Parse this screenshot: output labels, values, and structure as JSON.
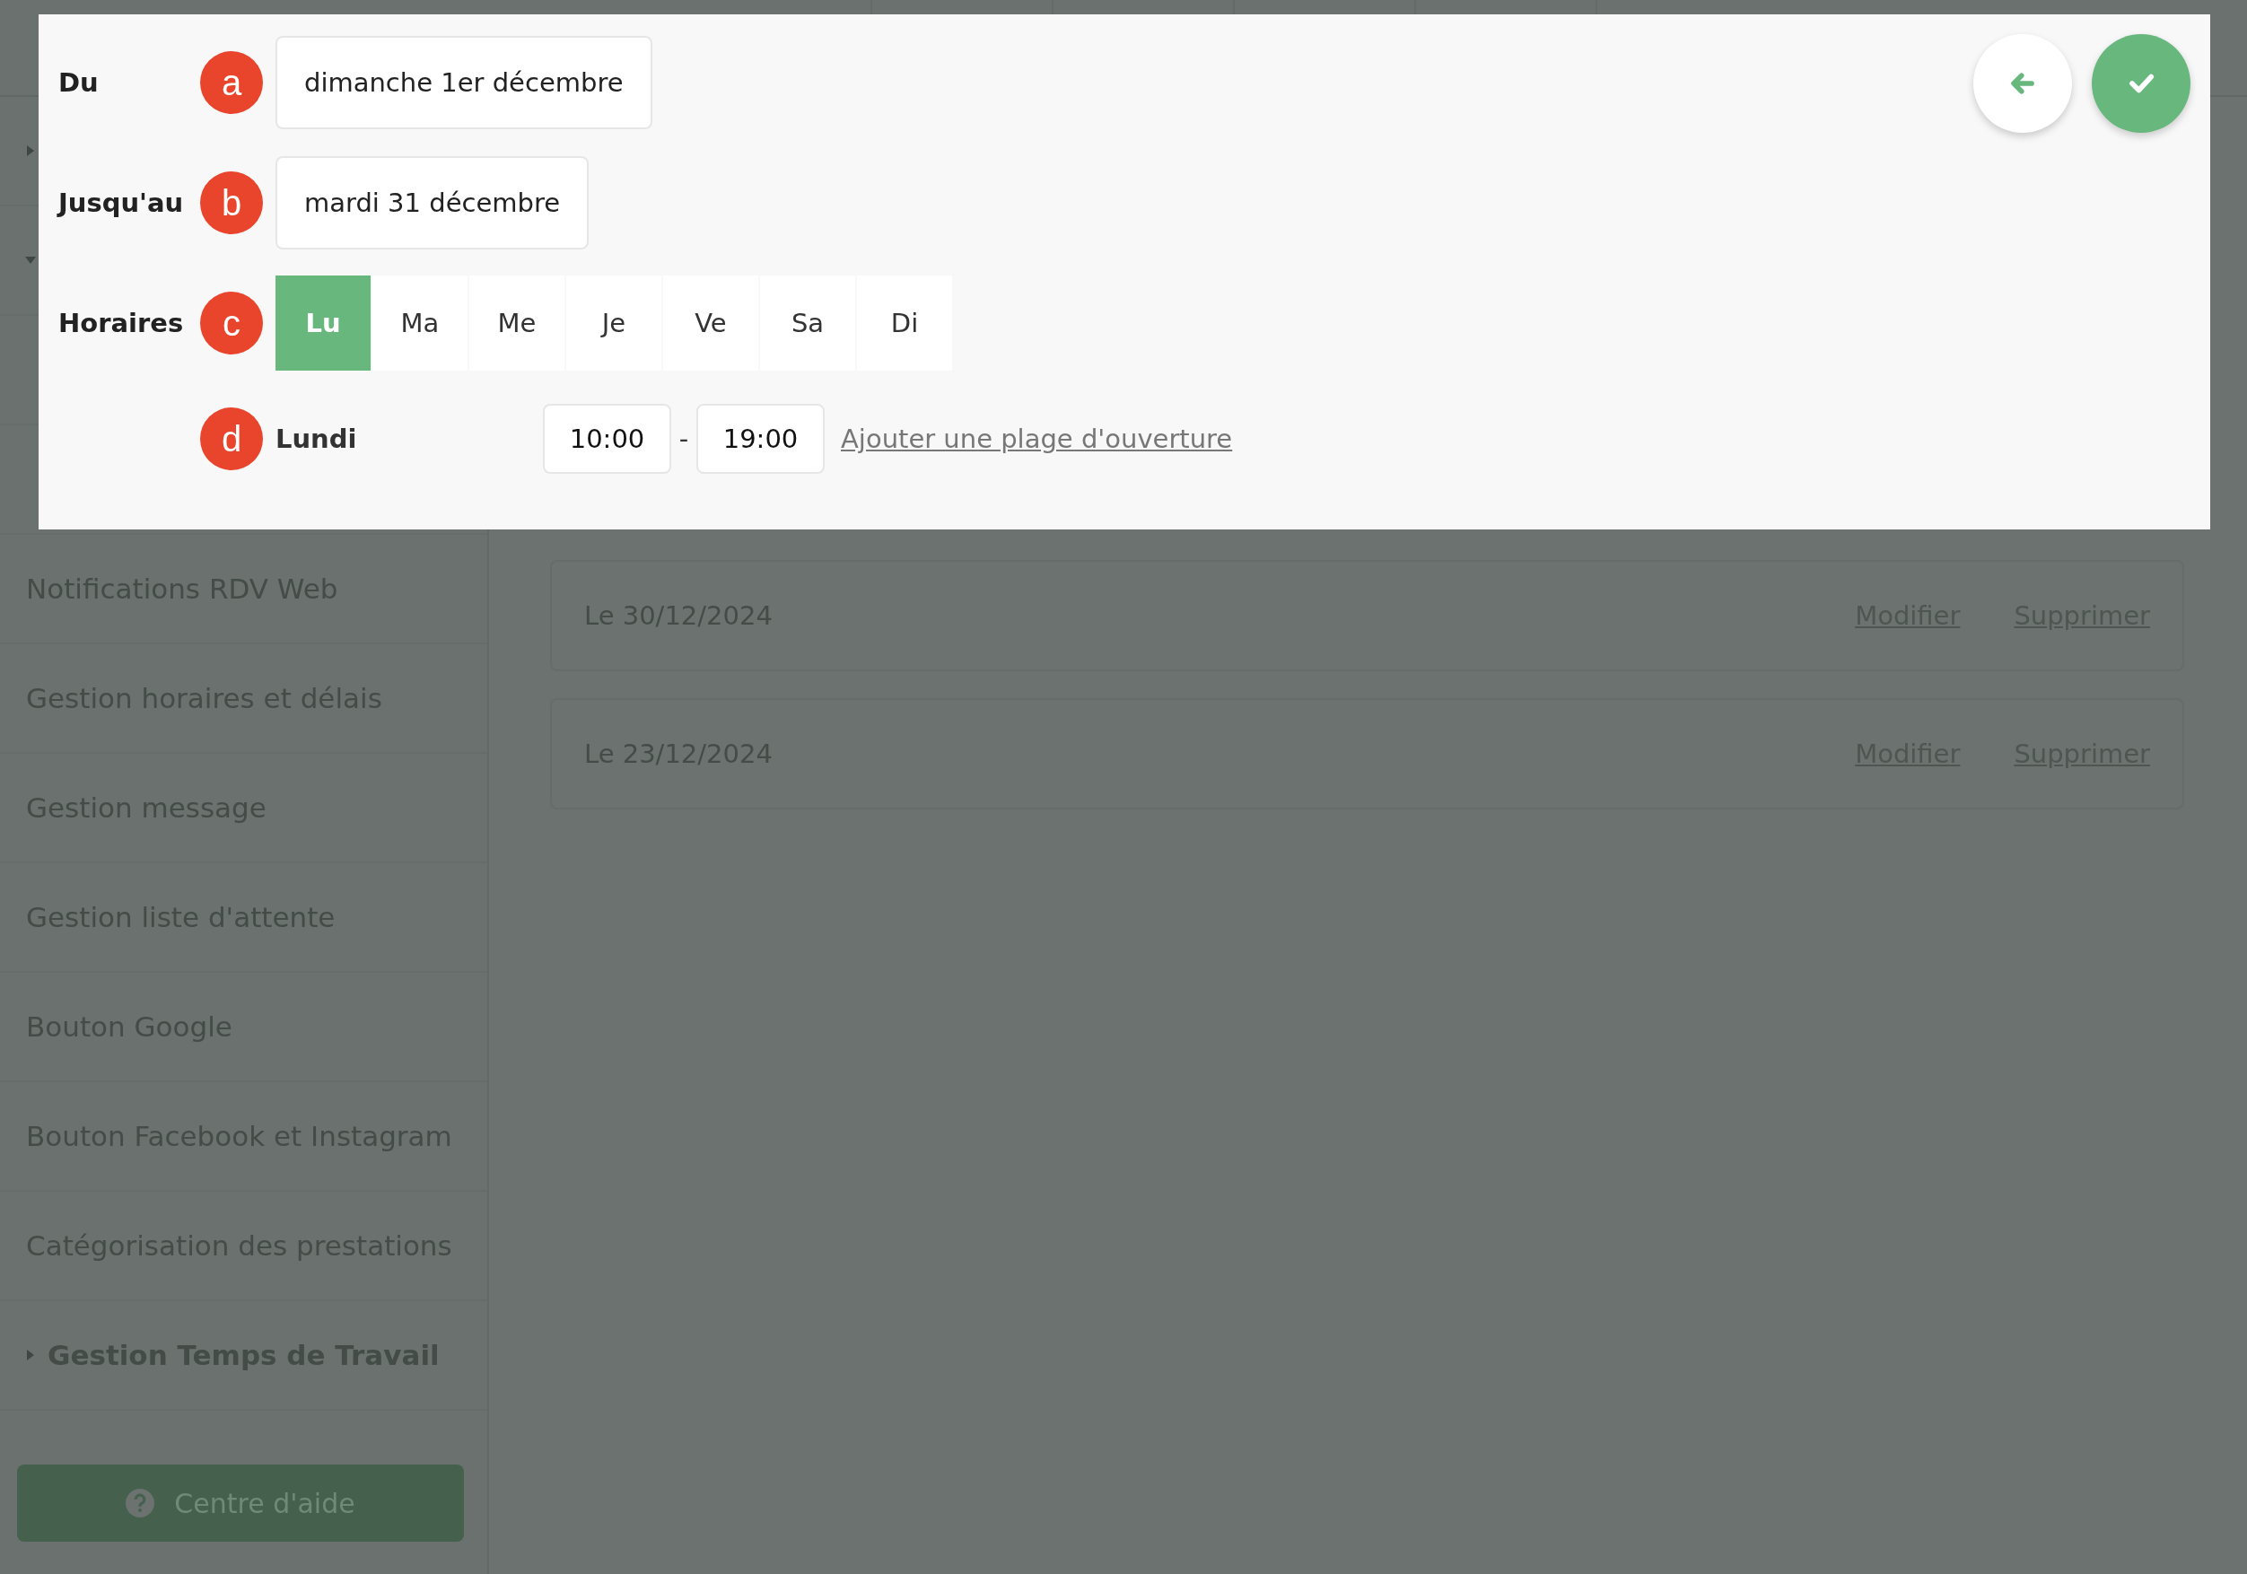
{
  "sidebar": {
    "items": [
      {
        "kind": "group",
        "expanded": false
      },
      {
        "kind": "group",
        "expanded": true
      },
      {
        "kind": "blank"
      },
      {
        "kind": "blank"
      },
      {
        "kind": "link",
        "label": "Notifications RDV Web"
      },
      {
        "kind": "link",
        "label": "Gestion horaires et délais"
      },
      {
        "kind": "link",
        "label": "Gestion message"
      },
      {
        "kind": "link",
        "label": "Gestion liste d'attente"
      },
      {
        "kind": "link",
        "label": "Bouton Google"
      },
      {
        "kind": "link",
        "label": "Bouton Facebook et Instagram"
      },
      {
        "kind": "link",
        "label": "Catégorisation des prestations"
      },
      {
        "kind": "group",
        "label": "Gestion Temps de Travail",
        "expanded": false
      }
    ],
    "help_button": "Centre d'aide"
  },
  "closures": [
    {
      "date": "Le 30/12/2024",
      "edit": "Modifier",
      "delete": "Supprimer"
    },
    {
      "date": "Le 23/12/2024",
      "edit": "Modifier",
      "delete": "Supprimer"
    }
  ],
  "modal": {
    "fields": [
      {
        "label": "Du",
        "badge": "a",
        "value": "dimanche 1er décembre"
      },
      {
        "label": "Jusqu'au",
        "badge": "b",
        "value": "mardi 31 décembre"
      }
    ],
    "schedule": {
      "label": "Horaires",
      "badge": "c",
      "days": [
        {
          "label": "Lu",
          "selected": true
        },
        {
          "label": "Ma",
          "selected": false
        },
        {
          "label": "Me",
          "selected": false
        },
        {
          "label": "Je",
          "selected": false
        },
        {
          "label": "Ve",
          "selected": false
        },
        {
          "label": "Sa",
          "selected": false
        },
        {
          "label": "Di",
          "selected": false
        }
      ]
    },
    "day_row": {
      "badge": "d",
      "day": "Lundi",
      "start": "10:00",
      "separator": "-",
      "end": "19:00",
      "add_link": "Ajouter une plage d'ouverture"
    }
  }
}
